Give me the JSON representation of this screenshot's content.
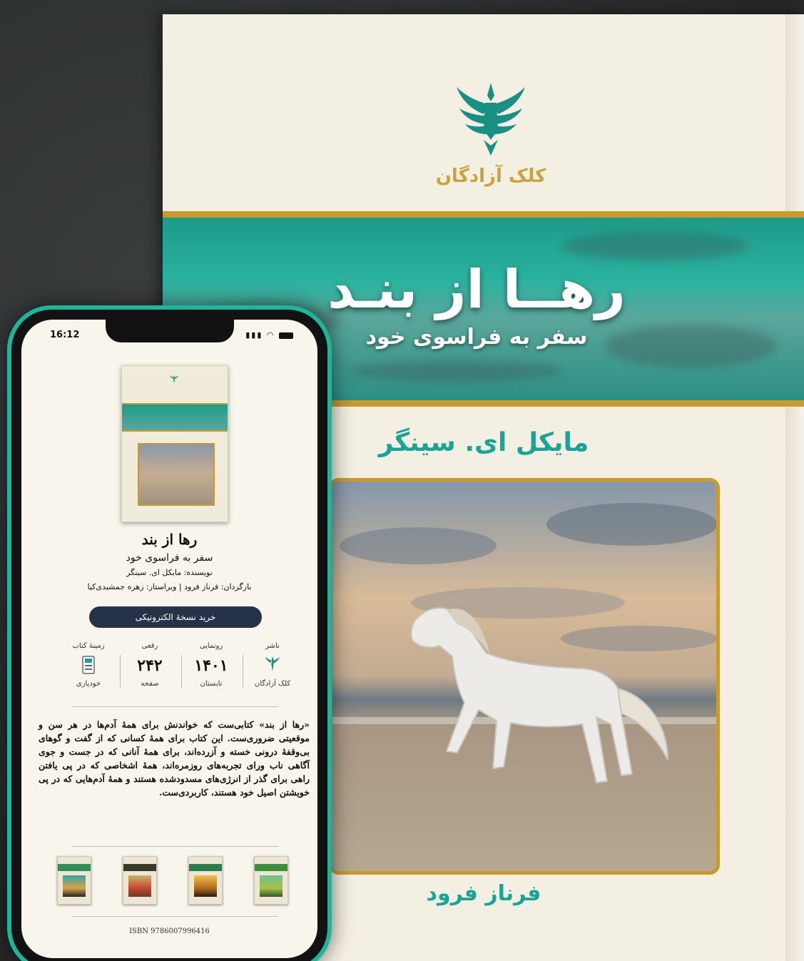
{
  "cover": {
    "publisher_name": "کلک آزادگان",
    "title": "رهــا از بنـد",
    "subtitle": "سفر به فراسوی خود",
    "author": "مایکل ای. سینگر",
    "translator": "فرناز فرود"
  },
  "phone": {
    "status_time": "16:12",
    "book_title": "رها از بند",
    "book_subtitle": "سفر به فراسوی خود",
    "author_line": "نویسنده: مایکل ای. سینگر",
    "translator_line": "بازگردان: فرناز فرود | ویراستار: زهره جمشیدی‌کیا",
    "buy_button": "خرید نسخهٔ الکترونیکی",
    "info": [
      {
        "header": "ناشر",
        "value": "",
        "sub": "کلک آزادگان",
        "icon": "publisher-logo-icon"
      },
      {
        "header": "رونمایی",
        "value": "۱۴۰۱",
        "sub": "تابستان"
      },
      {
        "header": "رقعی",
        "value": "۲۴۲",
        "sub": "صفحه"
      },
      {
        "header": "زمینهٔ کتاب",
        "value": "",
        "sub": "خودیاری",
        "icon": "calculator-icon"
      }
    ],
    "description": "«رها از بند» کتابی‌ست که خواندنش برای همهٔ آدم‌ها در هر سن و موقعیتی ضروری‌ست. این کتاب برای همهٔ کسانی که از گفت و گوهای بی‌وقفهٔ درونی خسته و آزرده‌اند، برای همهٔ آنانی که در جست و جوی آگاهی ناب ورای تجربه‌های روزمره‌اند، همهٔ اشخاصی که در پی یافتن راهی برای گذر از انرژی‌های مسدودشده هستند و همهٔ آدم‌هایی که در پی خویشتن اصیل خود هستند، کاربردی‌ست.",
    "isbn": "ISBN 9786007996416"
  },
  "colors": {
    "teal": "#1aa396",
    "gold": "#c99a2e",
    "navy_button": "#263247",
    "paper": "#f4efe3"
  }
}
